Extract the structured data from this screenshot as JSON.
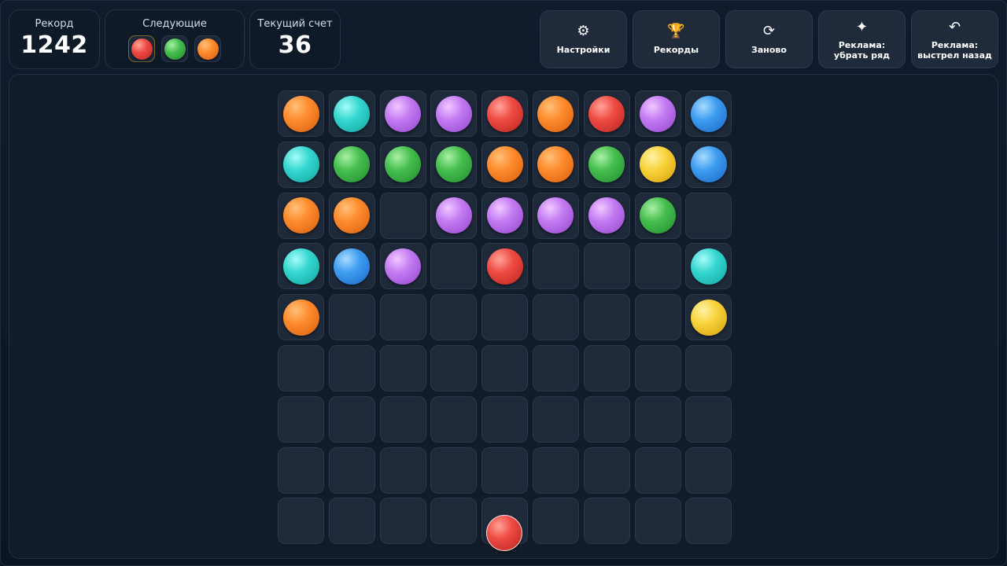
{
  "record": {
    "label": "Рекорд",
    "value": "1242"
  },
  "next": {
    "label": "Следующие",
    "balls": [
      "red",
      "green",
      "orange"
    ]
  },
  "score": {
    "label": "Текущий счет",
    "value": "36"
  },
  "toolbar": [
    {
      "id": "settings",
      "icon": "⚙",
      "icon_name": "gear-icon",
      "label": "Настройки"
    },
    {
      "id": "records",
      "icon": "🏆",
      "icon_name": "trophy-icon",
      "label": "Рекорды"
    },
    {
      "id": "restart",
      "icon": "⟳",
      "icon_name": "restart-icon",
      "label": "Заново"
    },
    {
      "id": "ad-remove-row",
      "icon": "✦",
      "icon_name": "sparkle-icon",
      "label": "Реклама: убрать ряд"
    },
    {
      "id": "ad-undo-shot",
      "icon": "↶",
      "icon_name": "undo-icon",
      "label": "Реклама: выстрел назад"
    }
  ],
  "board": {
    "cols": 9,
    "rows": 9,
    "cells": [
      [
        "orange",
        "cyan",
        "purple",
        "purple",
        "red",
        "orange",
        "red",
        "purple",
        "blue"
      ],
      [
        "cyan",
        "green",
        "green",
        "green",
        "orange",
        "orange",
        "green",
        "yellow",
        "blue"
      ],
      [
        "orange",
        "orange",
        "",
        "purple",
        "purple",
        "purple",
        "purple",
        "green",
        ""
      ],
      [
        "cyan",
        "blue",
        "purple",
        "",
        "red",
        "",
        "",
        "",
        "cyan"
      ],
      [
        "orange",
        "",
        "",
        "",
        "",
        "",
        "",
        "",
        "yellow"
      ],
      [
        "",
        "",
        "",
        "",
        "",
        "",
        "",
        "",
        ""
      ],
      [
        "",
        "",
        "",
        "",
        "",
        "",
        "",
        "",
        ""
      ],
      [
        "",
        "",
        "",
        "",
        "",
        "",
        "",
        "",
        ""
      ],
      [
        "",
        "",
        "",
        "",
        "",
        "",
        "",
        "",
        ""
      ]
    ]
  },
  "shooter": {
    "color": "red",
    "column": 5
  }
}
